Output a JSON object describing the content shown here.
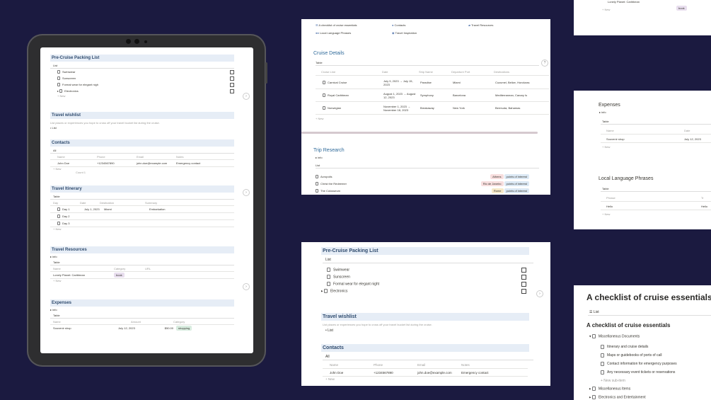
{
  "tablet": {
    "packing": {
      "title": "Pre-Cruise Packing List",
      "view": "List",
      "items": [
        "Swimwear",
        "Sunscreen",
        "Formal wear for elegant nigh",
        "Electronics"
      ],
      "new": "+ New"
    },
    "wishlist": {
      "title": "Travel wishlist",
      "desc": "List places or experiences you hope to cross off your travel bucket list during the cruise.",
      "item": "List"
    },
    "contacts": {
      "title": "Contacts",
      "view": "All",
      "headers": [
        "Name",
        "Phone",
        "Email",
        "Notes"
      ],
      "row": [
        "John Doe",
        "+1234567890",
        "john.doe@example.com",
        "Emergency contact"
      ],
      "new": "+ New",
      "count": "Count 1"
    },
    "itinerary": {
      "title": "Travel Itinerary",
      "view": "Table",
      "headers": [
        "Day",
        "Date",
        "Destination",
        "Summary"
      ],
      "rows": [
        [
          "Day 1",
          "July 1, 2023",
          "Miami",
          "Embarkation"
        ],
        [
          "Day 2",
          "",
          "",
          ""
        ],
        [
          "Day 3",
          "",
          "",
          ""
        ]
      ],
      "new": "+ New"
    },
    "resources": {
      "title": "Travel Resources",
      "info": "info",
      "view": "Table",
      "headers": [
        "Name",
        "Category",
        "URL"
      ],
      "row": [
        "Lonely Planet: Caribbean",
        "book",
        ""
      ],
      "new": "+ New"
    },
    "expenses": {
      "title": "Expenses",
      "info": "info",
      "view": "Table",
      "headers": [
        "Name",
        "Amount",
        "Category"
      ],
      "row": [
        "Souvenir shop",
        "July 12, 2023",
        "$50.00",
        "shopping"
      ]
    }
  },
  "top_panel": {
    "links": [
      "A checklist of cruise essentials",
      "Contacts",
      "Travel Resources",
      "Local Language Phrases",
      "Travel Inspiration"
    ],
    "cruise": {
      "title": "Cruise Details",
      "view": "Table",
      "headers": [
        "Cruise Line",
        "Date",
        "Ship Name",
        "Departure Port",
        "Destinations"
      ],
      "rows": [
        [
          "Carnival Cruise",
          "July 9, 2023 → July 15, 2023",
          "Paradise",
          "Miami",
          "Cozumel, Belize, Honduras"
        ],
        [
          "Royal Caribbean",
          "August 1, 2023 → August 12, 2023",
          "Symphony",
          "Barcelona",
          "Mediterranean, Canary Is"
        ],
        [
          "Norwegian",
          "November 1, 2023 → November 18, 2023",
          "Breakaway",
          "New York",
          "Bermuda, Bahamas"
        ]
      ],
      "new": "+ New"
    },
    "trip": {
      "title": "Trip Research",
      "info": "info",
      "view": "List",
      "rows": [
        {
          "name": "Acropolis",
          "tag1": "Athens",
          "tag2": "points of interest"
        },
        {
          "name": "Christ the Redeemer",
          "tag1": "Rio de Janeiro",
          "tag2": "points of interest"
        },
        {
          "name": "The Colosseum",
          "tag1": "Rome",
          "tag2": "points of interest"
        }
      ]
    }
  },
  "mid_panel": {
    "packing": {
      "title": "Pre-Cruise Packing List",
      "view": "List",
      "items": [
        "Swimwear",
        "Sunscreen",
        "Formal wear for elegant night",
        "Electronics"
      ]
    },
    "wishlist": {
      "title": "Travel wishlist",
      "desc": "List places or experiences you hope to cross off your travel bucket list during the cruise.",
      "item": "List"
    },
    "contacts": {
      "title": "Contacts",
      "view": "All",
      "headers": [
        "Name",
        "Phone",
        "Email",
        "Notes"
      ],
      "row": [
        "John Doe",
        "+1234567890",
        "john.doe@example.com",
        "Emergency contact"
      ],
      "new": "+ New"
    }
  },
  "right_top": {
    "row": "Lonely Planet: Caribbean",
    "tag": "book",
    "new": "+ New"
  },
  "right_mid": {
    "expenses": {
      "title": "Expenses",
      "info": "info",
      "view": "Table",
      "headers": [
        "Name",
        "Date"
      ],
      "row": [
        "Souvenir shop",
        "July 12, 2023"
      ],
      "new": "+ New"
    },
    "phrases": {
      "title": "Local Language Phrases",
      "view": "Table",
      "headers": [
        "Phrase",
        "Tr"
      ],
      "row": [
        "Hello",
        "Hello"
      ],
      "new": "+ New"
    }
  },
  "right_bottom": {
    "big_title": "A checklist of cruise essentials",
    "view": "List",
    "sub_title": "A checklist of cruise essentials",
    "group": "Miscellaneous Documents",
    "items": [
      "Itinerary and cruise details",
      "Maps or guidebooks of ports of call",
      "Contact information for emergency purposes",
      "Any necessary event tickets or reservations"
    ],
    "new_sub": "+ New sub-item",
    "more": [
      "Miscellaneous Items",
      "Electronics and Entertainment"
    ]
  }
}
